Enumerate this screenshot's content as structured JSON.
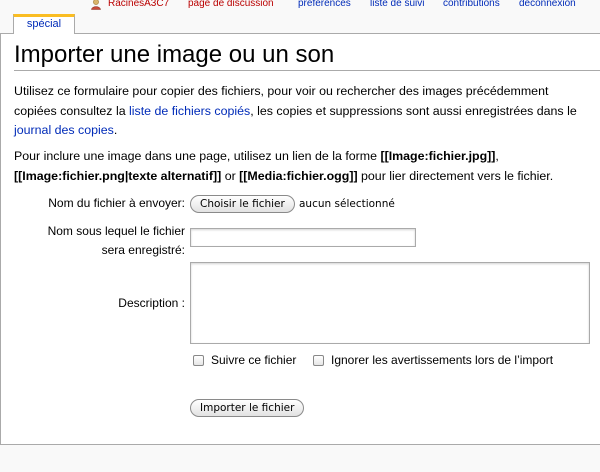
{
  "personal_tools": {
    "username": "RacinesA3C7",
    "talk": "page de discussion",
    "preferences": "préférences",
    "watchlist": "liste de suivi",
    "contributions": "contributions",
    "logout": "déconnexion"
  },
  "tabs": {
    "special": "spécial"
  },
  "page": {
    "title": "Importer une image ou un son",
    "intro_1": "Utilisez ce formulaire pour copier des fichiers, pour voir ou rechercher des images précédemment copiées consultez la ",
    "intro_link1": "liste de fichiers copiés",
    "intro_2": ", les copies et suppressions sont aussi enregistrées dans le ",
    "intro_link2": "journal des copies",
    "intro_3": ".",
    "usage_1": "Pour inclure une image dans une page, utilisez un lien de la forme ",
    "usage_code1": "[[Image:fichier.jpg]]",
    "usage_sep1": ",",
    "usage_code2": "[[Image:fichier.png|texte alternatif]]",
    "usage_or": " or ",
    "usage_code3": "[[Media:fichier.ogg]]",
    "usage_end": " pour lier directement vers le fichier."
  },
  "form": {
    "file_label": "Nom du fichier à envoyer:",
    "choose_button": "Choisir le fichier",
    "no_file": "aucun sélectionné",
    "dest_label_line1": "Nom sous lequel le fichier",
    "dest_label_line2": "sera enregistré:",
    "dest_value": "",
    "desc_label": "Description :",
    "desc_value": "",
    "watch_label": "Suivre ce fichier",
    "ignore_label": "Ignorer les avertissements lors de l’import",
    "submit": "Importer le fichier"
  },
  "colors": {
    "link": "#002bb8",
    "redlink": "#ba0000",
    "tab_accent": "#fabd23"
  },
  "icons": {
    "user": "user-icon"
  }
}
